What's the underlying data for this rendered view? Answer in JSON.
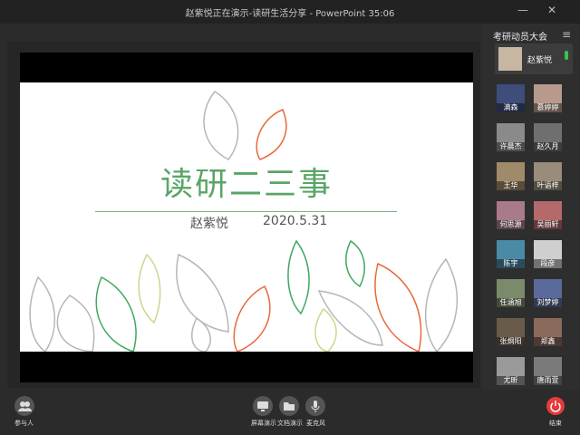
{
  "window": {
    "title": "赵紫悦正在演示-读研生活分享 - PowerPoint 35:06"
  },
  "slide": {
    "title": "读研二三事",
    "author": "赵紫悦",
    "date": "2020.5.31"
  },
  "panel": {
    "title": "考研动员大会",
    "presenter": {
      "name": "赵紫悦"
    },
    "participants": [
      {
        "name": "满森"
      },
      {
        "name": "慕婷婷"
      },
      {
        "name": "许晨杰"
      },
      {
        "name": "赵久月"
      },
      {
        "name": "王华"
      },
      {
        "name": "叶语梓"
      },
      {
        "name": "何思源"
      },
      {
        "name": "吴丽轩"
      },
      {
        "name": "陈宇"
      },
      {
        "name": "段彦"
      },
      {
        "name": "任涵旭"
      },
      {
        "name": "刘梦婷"
      },
      {
        "name": "张炯阳"
      },
      {
        "name": "郑鑫"
      },
      {
        "name": "尤昕"
      },
      {
        "name": "唐雨萱"
      }
    ]
  },
  "toolbar": {
    "participants": "参与人",
    "screen_share": "屏幕演示",
    "doc_share": "文档演示",
    "mic": "麦克风",
    "end": "结束"
  }
}
